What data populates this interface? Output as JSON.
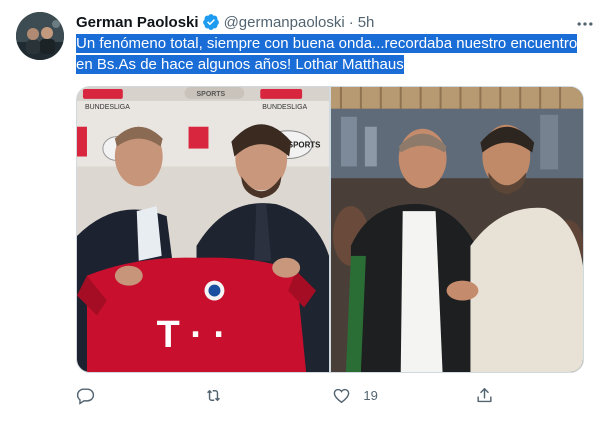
{
  "tweet": {
    "author_name": "German Paoloski",
    "handle": "@germanpaoloski",
    "separator": "·",
    "time": "5h",
    "text": "Un fenómeno total, siempre con buena onda...recordaba nuestro encuentro en Bs.As de hace algunos años! Lothar Matthaus",
    "selection_color": "#1a6dd6"
  },
  "media": {
    "photo_1": {
      "backdrop_text": [
        "BUNDESLIGA",
        "FOX SPORTS",
        "SPORTS",
        "BUNDESLIGA"
      ],
      "jersey_text": "T · ·"
    },
    "photo_2": {}
  },
  "actions": {
    "reply_count": "",
    "retweet_count": "",
    "like_count": "19",
    "share_count": ""
  },
  "icons": {
    "verified": "verified-badge-icon",
    "more": "more-options-icon",
    "reply": "reply-icon",
    "retweet": "retweet-icon",
    "like": "heart-icon",
    "share": "share-icon"
  },
  "colors": {
    "accent": "#1d9bf0",
    "muted": "#536471"
  }
}
